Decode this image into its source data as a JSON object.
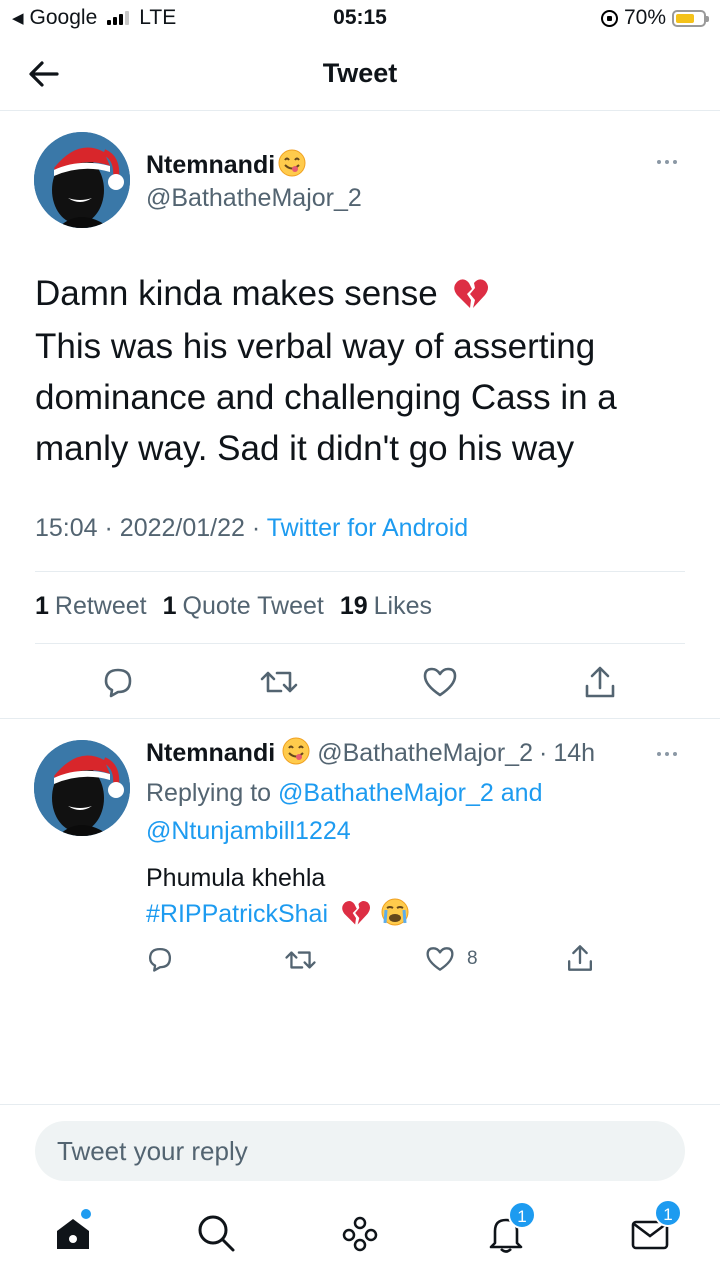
{
  "status_bar": {
    "carrier": "Google",
    "network": "LTE",
    "time": "05:15",
    "battery": "70%",
    "battery_level": 0.7
  },
  "header": {
    "title": "Tweet"
  },
  "main_tweet": {
    "name": "Ntemnandi",
    "handle": "@BathatheMajor_2",
    "lines": [
      "Damn kinda makes sense",
      "This was his verbal way of asserting",
      "dominance and challenging Cass in a",
      "manly way. Sad it didn't go his way"
    ],
    "time": "15:04",
    "date": "2022/01/22",
    "source": "Twitter for Android",
    "stats": {
      "retweets_count": "1",
      "retweets_label": "Retweet",
      "quotes_count": "1",
      "quotes_label": "Quote Tweet",
      "likes_count": "19",
      "likes_label": "Likes"
    }
  },
  "reply": {
    "name": "Ntemnandi",
    "handle": "@BathatheMajor_2",
    "age": "14h",
    "replying_prefix": "Replying to",
    "replying_user1": "@BathatheMajor_2",
    "replying_and": "and",
    "replying_user2": "@Ntunjambill1224",
    "line1": "Phumula khehla",
    "hashtag": "#RIPPatrickShai",
    "likes": "8"
  },
  "composer": {
    "placeholder": "Tweet your reply"
  },
  "bottom_nav": {
    "notifications_badge": "1",
    "messages_badge": "1"
  },
  "colors": {
    "accent": "#1d9bf0",
    "secondary_text": "#536471"
  }
}
